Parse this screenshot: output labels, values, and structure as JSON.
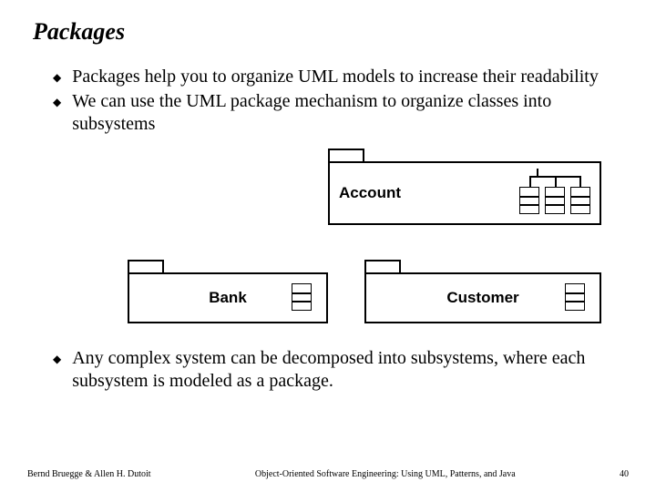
{
  "title": "Packages",
  "bullets": {
    "top": [
      "Packages help  you to organize UML models to increase their readability",
      "We can use the UML package mechanism to organize classes into subsystems"
    ],
    "bottom": [
      "Any complex system can be decomposed into subsystems, where each subsystem is modeled as a package."
    ]
  },
  "packages": {
    "account": "Account",
    "bank": "Bank",
    "customer": "Customer"
  },
  "footer": {
    "left": "Bernd Bruegge & Allen H. Dutoit",
    "center": "Object-Oriented Software Engineering: Using UML, Patterns, and Java",
    "right": "40"
  }
}
